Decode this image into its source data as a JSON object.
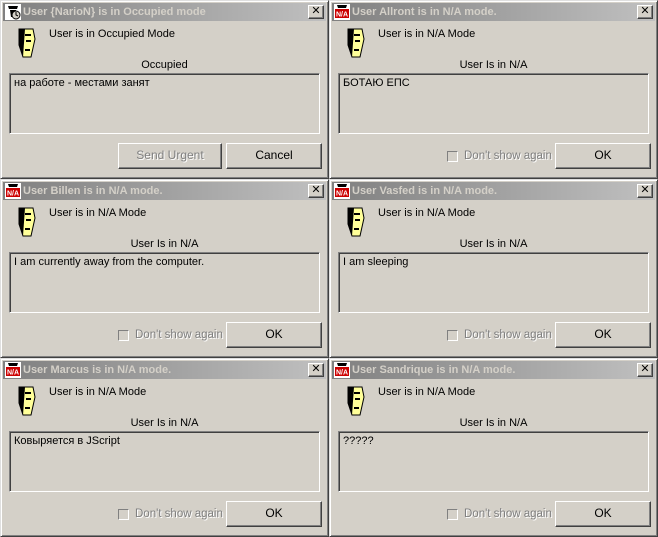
{
  "icons": {
    "titlebar_occupied": "occupied-status-icon",
    "titlebar_na": "na-status-icon",
    "mode_face": "user-face-icon",
    "close": "close-icon"
  },
  "colors": {
    "dialog_bg": "#d4d0c8",
    "titlebar_inactive_start": "#808080",
    "titlebar_inactive_end": "#c0c0c0",
    "na_icon_red": "#cc0000"
  },
  "close_glyph": "✕",
  "dialogs": [
    {
      "title": "User {NarioN} is in Occupied mode",
      "mode_line": "User is in Occupied Mode",
      "status_caption": "Occupied",
      "message": "на работе - местами занят",
      "buttons": {
        "send_urgent": "Send Urgent",
        "cancel": "Cancel"
      }
    },
    {
      "title": "User Allront is in N/A mode.",
      "mode_line": "User is in N/A Mode",
      "status_caption": "User Is in N/A",
      "message": "БОТАЮ ЕПС",
      "dont_show_again": "Don't show again",
      "ok": "OK"
    },
    {
      "title": "User Billen is in N/A mode.",
      "mode_line": "User is in N/A Mode",
      "status_caption": "User Is in N/A",
      "message": "I am currently away from the computer.",
      "dont_show_again": "Don't show again",
      "ok": "OK"
    },
    {
      "title": "User Vasfed is in N/A mode.",
      "mode_line": "User is in N/A Mode",
      "status_caption": "User Is in N/A",
      "message": "I am sleeping",
      "dont_show_again": "Don't show again",
      "ok": "OK"
    },
    {
      "title": "User Marcus is in N/A mode.",
      "mode_line": "User is in N/A Mode",
      "status_caption": "User Is in N/A",
      "message": "Ковыряется в JScript",
      "dont_show_again": "Don't show again",
      "ok": "OK"
    },
    {
      "title": "User Sandrique is in N/A mode.",
      "mode_line": "User is in N/A Mode",
      "status_caption": "User Is in N/A",
      "message": "?????",
      "dont_show_again": "Don't show again",
      "ok": "OK"
    }
  ]
}
